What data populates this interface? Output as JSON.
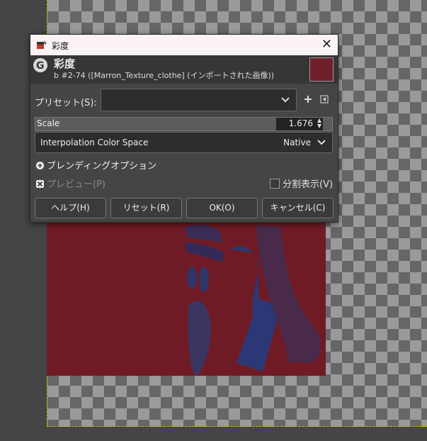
{
  "dialog": {
    "window_title": "彩度",
    "header_title": "彩度",
    "header_subtitle": "b  #2-74 ([Marron_Texture_clothe] (インポートされた画像))",
    "preset_label": "プリセット(S):",
    "preset_value": "",
    "scale_label": "Scale",
    "scale_value": "1.676",
    "interpolation_label": "Interpolation Color Space",
    "interpolation_value": "Native",
    "blending_options_label": "ブレンディングオプション",
    "preview_label": "プレビュー(P)",
    "split_view_label": "分割表示(V)",
    "buttons": {
      "help": "ヘルプ(H)",
      "reset": "リセット(R)",
      "ok": "OK(O)",
      "cancel": "キャンセル(C)"
    },
    "swatch_color": "#6f1f2a"
  }
}
